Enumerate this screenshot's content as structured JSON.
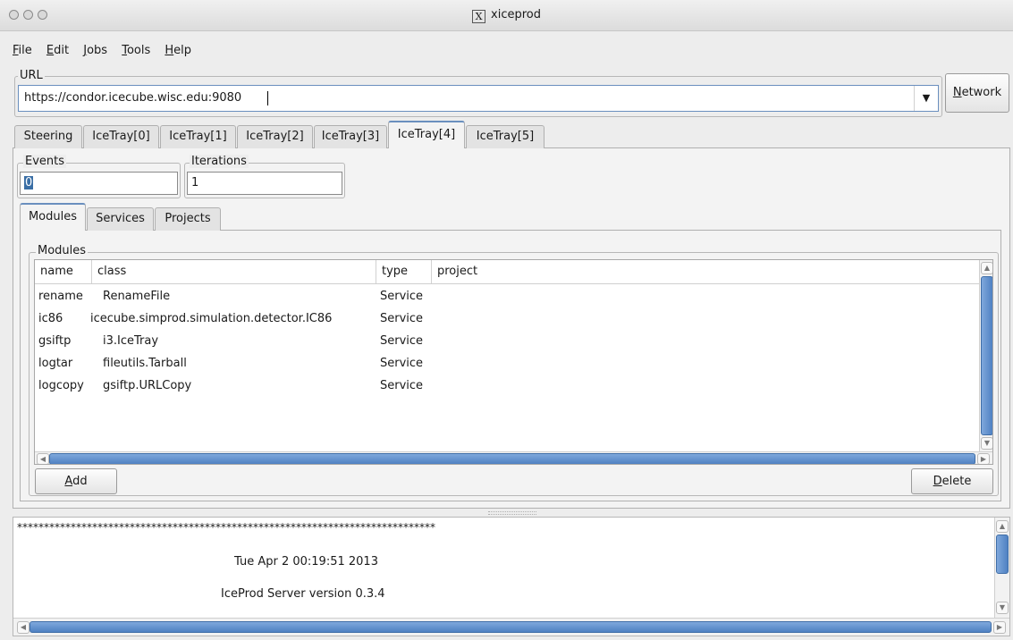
{
  "window": {
    "title": "xiceprod"
  },
  "menu": [
    {
      "mnemonic": "F",
      "rest": "ile"
    },
    {
      "mnemonic": "E",
      "rest": "dit"
    },
    {
      "mnemonic": "J",
      "rest": "obs"
    },
    {
      "mnemonic": "T",
      "rest": "ools"
    },
    {
      "mnemonic": "H",
      "rest": "elp"
    }
  ],
  "url": {
    "label": "URL",
    "value": "https://condor.icecube.wisc.edu:9080"
  },
  "network_button": {
    "mnemonic": "N",
    "rest": "etwork"
  },
  "tabs": [
    "Steering",
    "IceTray[0]",
    "IceTray[1]",
    "IceTray[2]",
    "IceTray[3]",
    "IceTray[4]",
    "IceTray[5]"
  ],
  "active_tab": "IceTray[4]",
  "events": {
    "label": "Events",
    "value": "0"
  },
  "iterations": {
    "label": "Iterations",
    "value": "1"
  },
  "subtabs": [
    "Modules",
    "Services",
    "Projects"
  ],
  "active_subtab": "Modules",
  "modules": {
    "label": "Modules",
    "columns": [
      "name",
      "class",
      "type",
      "project"
    ],
    "rows": [
      [
        "rename",
        "RenameFile",
        "Service",
        ""
      ],
      [
        "ic86",
        "icecube.simprod.simulation.detector.IC86",
        "Service",
        ""
      ],
      [
        "gsiftp",
        "i3.IceTray",
        "Service",
        ""
      ],
      [
        "logtar",
        "fileutils.Tarball",
        "Service",
        ""
      ],
      [
        "logcopy",
        "gsiftp.URLCopy",
        "Service",
        ""
      ]
    ]
  },
  "add_button": {
    "mnemonic": "A",
    "rest": "dd"
  },
  "delete_button": {
    "mnemonic": "D",
    "rest": "elete"
  },
  "log": {
    "stars": "******************************************************************************",
    "date": "Tue Apr  2 00:19:51 2013",
    "version": "IceProd Server version 0.3.4"
  }
}
